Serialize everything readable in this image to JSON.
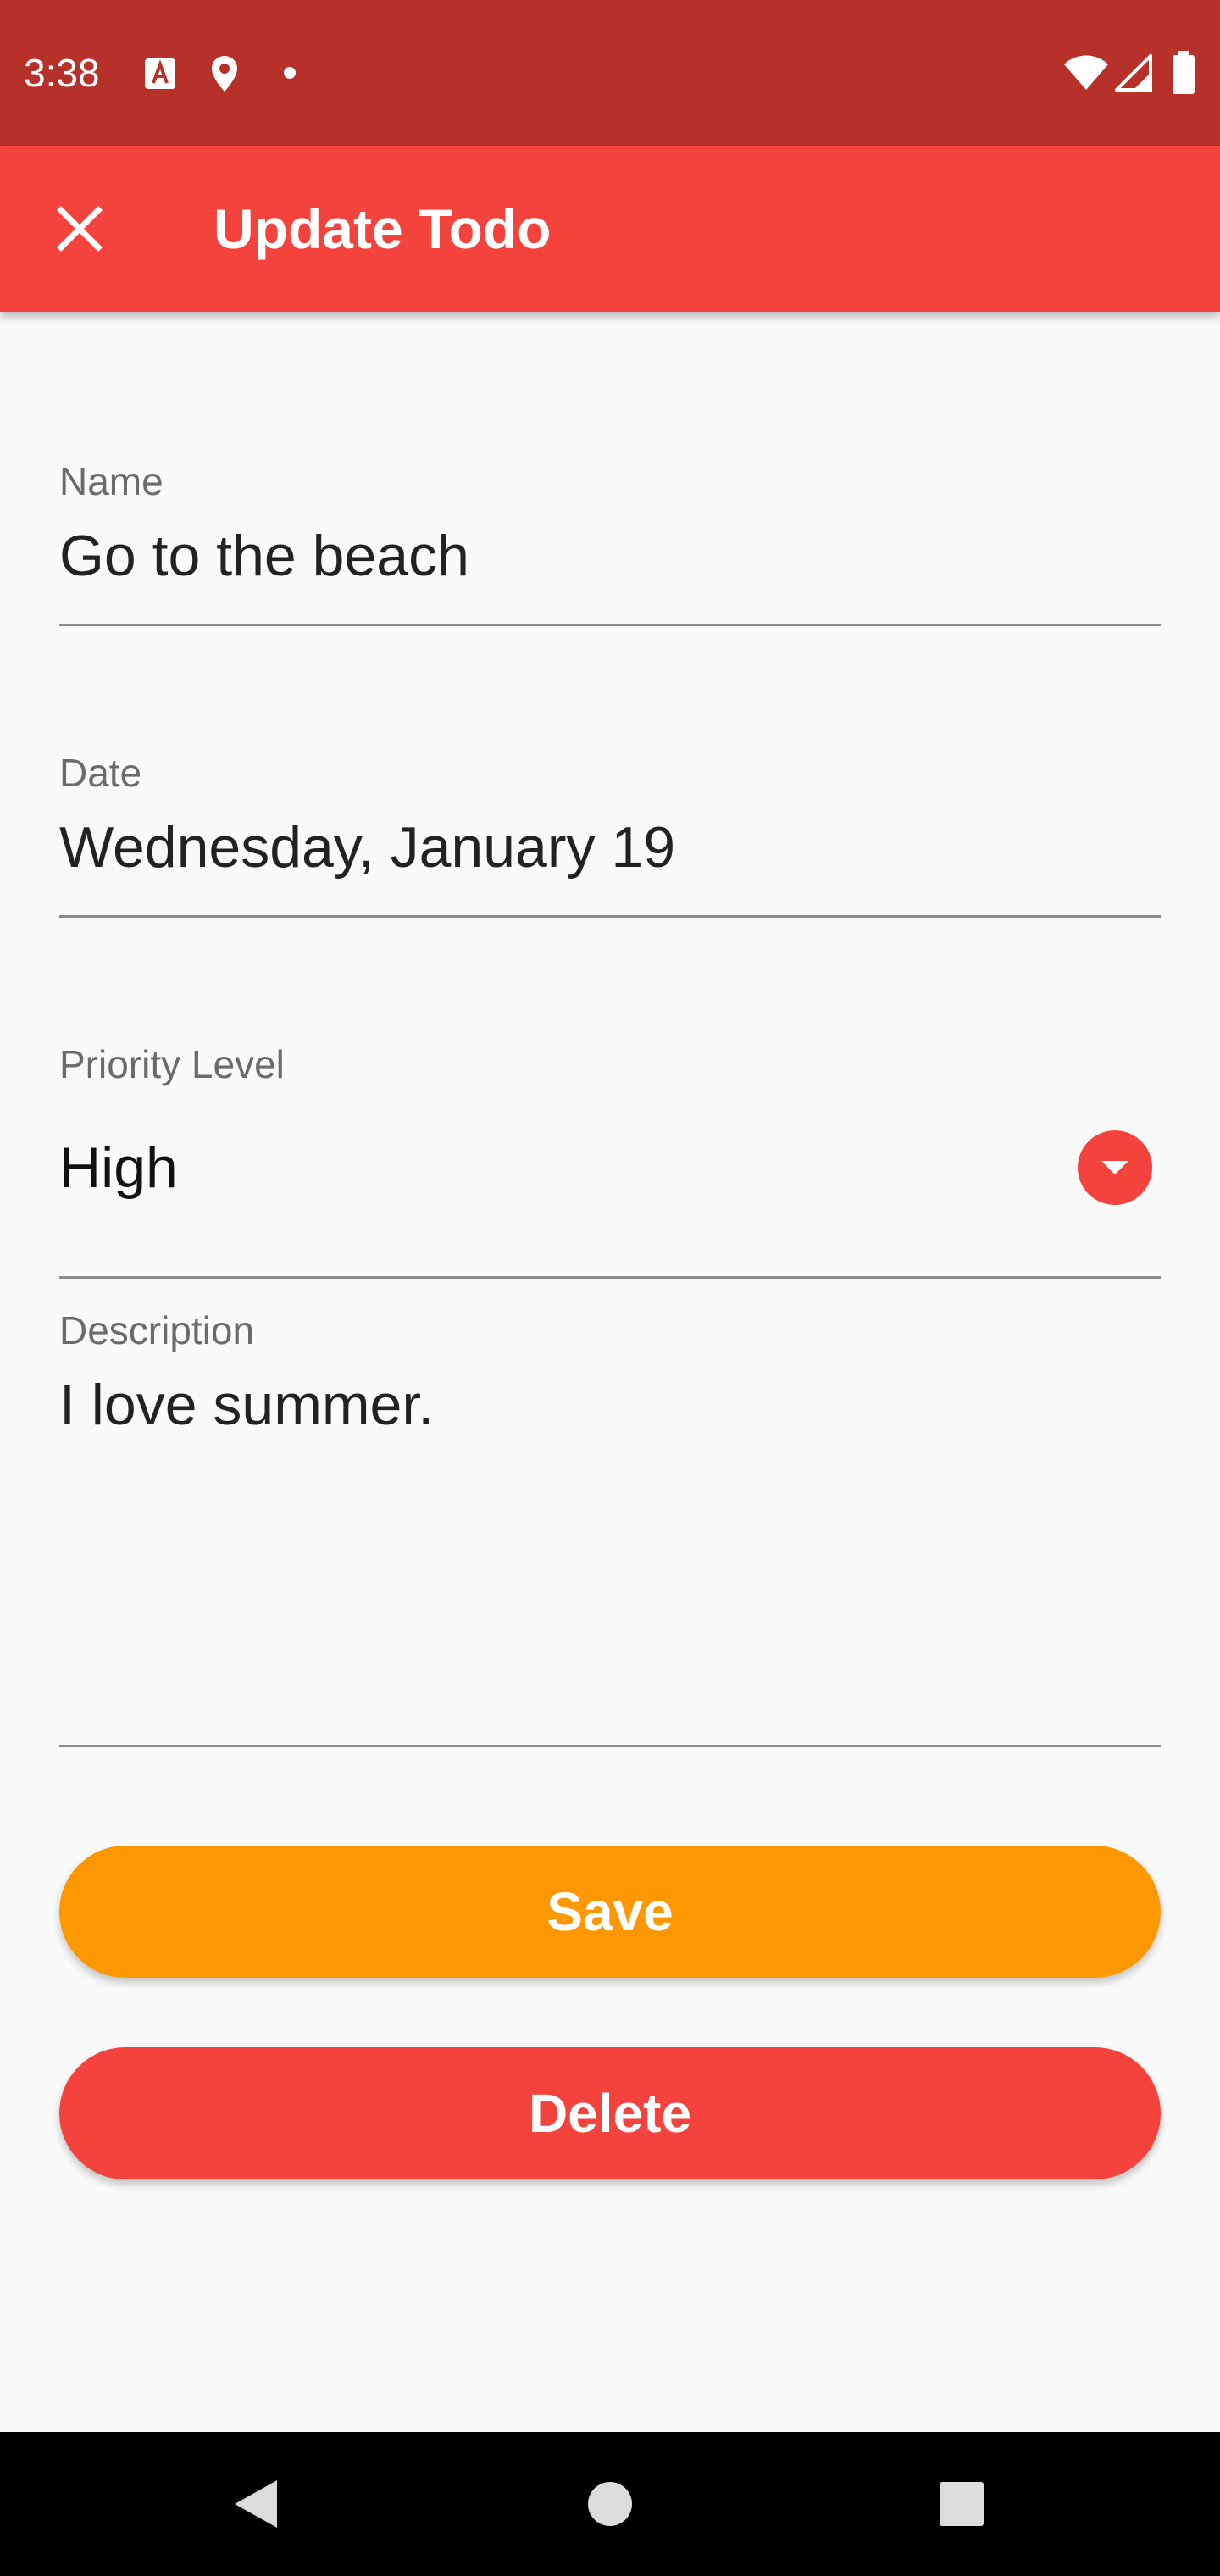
{
  "status_bar": {
    "time": "3:38",
    "left_icons": [
      "font-a-icon",
      "location-pin-icon",
      "dot-icon"
    ],
    "right_icons": [
      "wifi-icon",
      "cell-signal-icon",
      "battery-icon"
    ]
  },
  "app_bar": {
    "close_icon": "close-icon",
    "title": "Update Todo"
  },
  "form": {
    "name": {
      "label": "Name",
      "value": "Go to the beach"
    },
    "date": {
      "label": "Date",
      "value": "Wednesday, January 19"
    },
    "priority": {
      "label": "Priority Level",
      "value": "High",
      "dropdown_icon": "chevron-down-icon"
    },
    "description": {
      "label": "Description",
      "value": "I love summer."
    }
  },
  "actions": {
    "save_label": "Save",
    "delete_label": "Delete"
  },
  "nav_bar": {
    "icons": [
      "back-icon",
      "home-icon",
      "recents-icon"
    ]
  },
  "colors": {
    "status_bar": "#b7312b",
    "app_bar": "#f4433c",
    "save_button": "#ff9800",
    "delete_button": "#f4433c",
    "background": "#fafafa"
  }
}
